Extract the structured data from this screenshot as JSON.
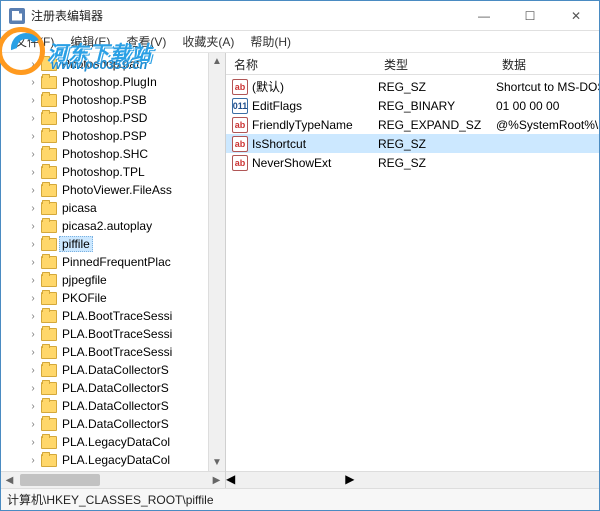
{
  "window": {
    "title": "注册表编辑器",
    "controls": {
      "min": "—",
      "max": "☐",
      "close": "✕"
    }
  },
  "menubar": {
    "file": "文件(F)",
    "edit": "编辑(E)",
    "view": "查看(V)",
    "fav": "收藏夹(A)",
    "help": "帮助(H)"
  },
  "watermark": {
    "brand": "河东下载站",
    "url": "www.pc0359.cn"
  },
  "tree": {
    "items": [
      {
        "label": "Photoshop.pat"
      },
      {
        "label": "Photoshop.PlugIn"
      },
      {
        "label": "Photoshop.PSB"
      },
      {
        "label": "Photoshop.PSD"
      },
      {
        "label": "Photoshop.PSP"
      },
      {
        "label": "Photoshop.SHC"
      },
      {
        "label": "Photoshop.TPL"
      },
      {
        "label": "PhotoViewer.FileAss"
      },
      {
        "label": "picasa"
      },
      {
        "label": "picasa2.autoplay"
      },
      {
        "label": "piffile",
        "selected": true
      },
      {
        "label": "PinnedFrequentPlac"
      },
      {
        "label": "pjpegfile"
      },
      {
        "label": "PKOFile"
      },
      {
        "label": "PLA.BootTraceSessi"
      },
      {
        "label": "PLA.BootTraceSessi"
      },
      {
        "label": "PLA.BootTraceSessi"
      },
      {
        "label": "PLA.DataCollectorS"
      },
      {
        "label": "PLA.DataCollectorS"
      },
      {
        "label": "PLA.DataCollectorS"
      },
      {
        "label": "PLA.DataCollectorS"
      },
      {
        "label": "PLA.LegacyDataCol"
      },
      {
        "label": "PLA.LegacyDataCol"
      }
    ]
  },
  "list": {
    "headers": {
      "name": "名称",
      "type": "类型",
      "data": "数据"
    },
    "rows": [
      {
        "icon": "str",
        "name": "(默认)",
        "type": "REG_SZ",
        "data": "Shortcut to MS-DOS P"
      },
      {
        "icon": "bin",
        "name": "EditFlags",
        "type": "REG_BINARY",
        "data": "01 00 00 00"
      },
      {
        "icon": "str",
        "name": "FriendlyTypeName",
        "type": "REG_EXPAND_SZ",
        "data": "@%SystemRoot%\\Sys"
      },
      {
        "icon": "str",
        "name": "IsShortcut",
        "type": "REG_SZ",
        "data": "",
        "selected": true
      },
      {
        "icon": "str",
        "name": "NeverShowExt",
        "type": "REG_SZ",
        "data": ""
      }
    ]
  },
  "statusbar": {
    "path": "计算机\\HKEY_CLASSES_ROOT\\piffile"
  }
}
